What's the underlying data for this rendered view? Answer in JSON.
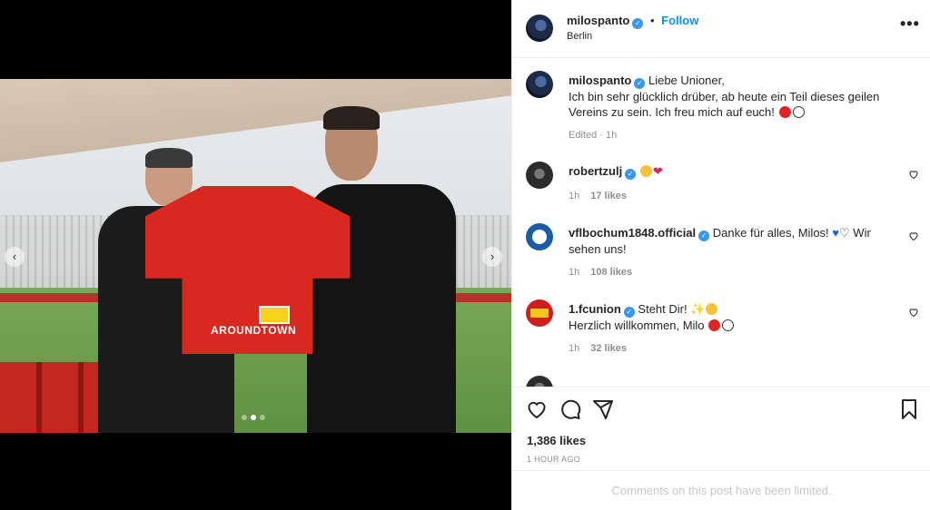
{
  "post": {
    "author": "milospanto",
    "location": "Berlin",
    "follow_label": "Follow",
    "more_label": "•••",
    "caption": {
      "username": "milospanto",
      "line1": "Liebe Unioner,",
      "line2": "Ich bin sehr glücklich drüber, ab heute ein Teil dieses geilen",
      "line3": "Vereins zu sein. Ich freu mich auf euch!",
      "meta": "Edited · 1h"
    },
    "photo_text": {
      "jersey": "AROUNDTOWN"
    },
    "nav": {
      "prev": "‹",
      "next": "›"
    }
  },
  "comments": [
    {
      "username": "robertzulj",
      "text": "",
      "time": "1h",
      "likes": "17 likes"
    },
    {
      "username": "vflbochum1848.official",
      "text": "Danke für alles, Milos!",
      "text2": "Wir",
      "line2": "sehen uns!",
      "time": "1h",
      "likes": "108 likes"
    },
    {
      "username": "1.fcunion",
      "text": "Steht Dir!",
      "line2": "Herzlich willkommen, Milo",
      "time": "1h",
      "likes": "32 likes"
    }
  ],
  "stats": {
    "likes": "1,386 likes",
    "time_ago": "1 HOUR AGO"
  },
  "footer": {
    "limited": "Comments on this post have been limited."
  },
  "icons": {
    "like": "heart-icon",
    "comment": "comment-icon",
    "share": "share-icon",
    "save": "bookmark-icon",
    "verified": "verified-badge-icon"
  },
  "colors": {
    "accent": "#0095f6",
    "verified": "#3897f0",
    "muted": "#8e8e8e"
  }
}
